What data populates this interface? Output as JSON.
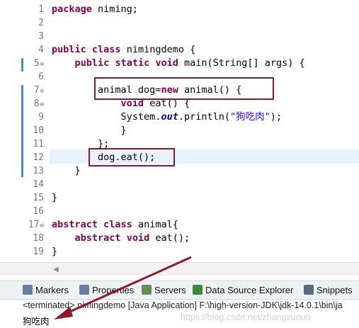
{
  "editor": {
    "lines": [
      {
        "num": "1",
        "fold": "",
        "html": "<span class=\"kw\">package</span> niming;"
      },
      {
        "num": "2",
        "fold": "",
        "html": ""
      },
      {
        "num": "3",
        "fold": "",
        "html": ""
      },
      {
        "num": "4",
        "fold": "",
        "html": "<span class=\"kw\">public</span> <span class=\"kw\">class</span> nimingdemo {"
      },
      {
        "num": "5",
        "fold": "⊖",
        "html": "    <span class=\"kw\">public</span> <span class=\"kw\">static</span> <span class=\"kw\">void</span> main(String[] args) {"
      },
      {
        "num": "6",
        "fold": "",
        "html": ""
      },
      {
        "num": "7",
        "fold": "⊖",
        "html": "        animal dog=<span class=\"kw\">new</span> animal() {"
      },
      {
        "num": "8",
        "fold": "⊖",
        "html": "            <span class=\"kw\">void</span> eat() {"
      },
      {
        "num": "9",
        "fold": "",
        "html": "            System.<span class=\"st\">out</span>.println(<span class=\"str\">\"狗吃肉\"</span>);"
      },
      {
        "num": "10",
        "fold": "",
        "html": "            }"
      },
      {
        "num": "11",
        "fold": "",
        "html": "        };"
      },
      {
        "num": "12",
        "fold": "",
        "html": "        dog.eat();"
      },
      {
        "num": "13",
        "fold": "",
        "html": "    }"
      },
      {
        "num": "14",
        "fold": "",
        "html": ""
      },
      {
        "num": "15",
        "fold": "",
        "html": "}"
      },
      {
        "num": "16",
        "fold": "",
        "html": ""
      },
      {
        "num": "17",
        "fold": "⊖",
        "html": "<span class=\"kw\">abstract</span> <span class=\"kw\">class</span> animal{"
      },
      {
        "num": "18",
        "fold": "",
        "html": "    <span class=\"kw\">abstract</span> <span class=\"kw\">void</span> eat();"
      },
      {
        "num": "19",
        "fold": "",
        "html": "}"
      }
    ]
  },
  "tabs": [
    {
      "label": "Markers",
      "icon": "markers-icon",
      "color": "#6a7fa0"
    },
    {
      "label": "Properties",
      "icon": "properties-icon",
      "color": "#6a7fa0"
    },
    {
      "label": "Servers",
      "icon": "servers-icon",
      "color": "#6a8a5a"
    },
    {
      "label": "Data Source Explorer",
      "icon": "data-source-icon",
      "color": "#3a8a3a"
    },
    {
      "label": "Snippets",
      "icon": "snippets-icon",
      "color": "#5a6a80"
    }
  ],
  "console": {
    "status": "<terminated> nimingdemo [Java Application] F:\\high-version-JDK\\jdk-14.0.1\\bin\\ja",
    "output": "狗吃肉",
    "watermark": "https://blog.csdn.net/zhangxuouo"
  },
  "colors": {
    "annotation": "#8b1a2a",
    "keyword": "#7f0055",
    "string": "#2a00ff"
  }
}
